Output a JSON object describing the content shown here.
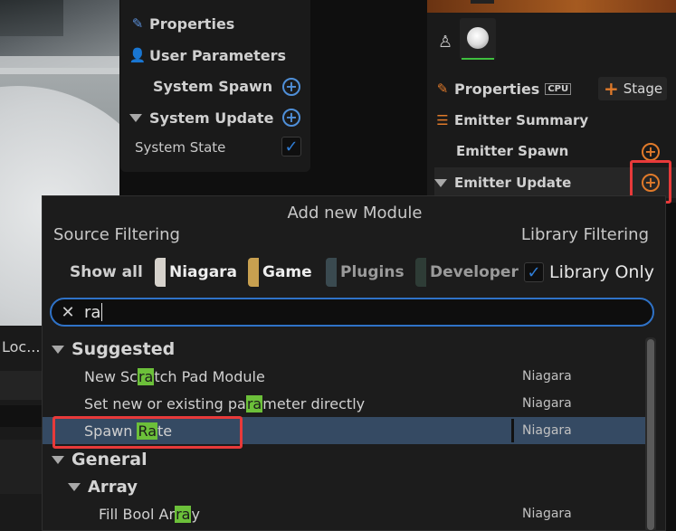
{
  "viewport_label": "Loc...",
  "system_panel": {
    "properties": "Properties",
    "user_parameters": "User Parameters",
    "system_spawn": "System Spawn",
    "system_update": "System Update",
    "system_state": "System State"
  },
  "emitter_panel": {
    "properties": "Properties",
    "cpu_badge": "CPU",
    "stage_button": "Stage",
    "emitter_summary": "Emitter Summary",
    "emitter_spawn": "Emitter Spawn",
    "emitter_update": "Emitter Update"
  },
  "popup": {
    "title": "Add new Module",
    "source_filtering": "Source Filtering",
    "library_filtering": "Library Filtering",
    "show_all": "Show all",
    "filters": [
      {
        "label": "Niagara",
        "color": "#d6d2cc",
        "active": true
      },
      {
        "label": "Game",
        "color": "#c8a050",
        "active": true
      },
      {
        "label": "Plugins",
        "color": "#3a4a50",
        "active": false
      },
      {
        "label": "Developer",
        "color": "#2e3c36",
        "active": false
      }
    ],
    "library_only": "Library Only",
    "search_value": "ra",
    "suggested": "Suggested",
    "general": "General",
    "array": "Array",
    "items": [
      {
        "pre": "New Sc",
        "match": "ra",
        "post": "tch Pad Module",
        "source": "Niagara"
      },
      {
        "pre": "Set new or existing pa",
        "match": "ra",
        "post": "meter directly",
        "source": "Niagara"
      },
      {
        "pre": "Spawn ",
        "match": "Ra",
        "post": "te",
        "source": "Niagara"
      },
      {
        "pre": "Fill Bool Ar",
        "match": "ra",
        "post": "y",
        "source": "Niagara"
      }
    ]
  }
}
